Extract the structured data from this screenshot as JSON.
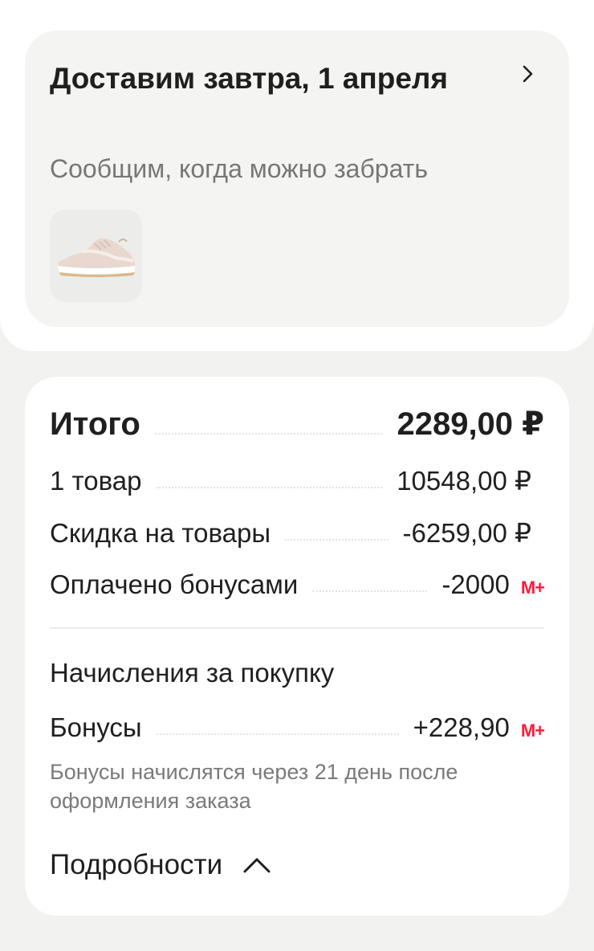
{
  "delivery": {
    "title": "Доставим завтра, 1 апреля",
    "subtitle": "Сообщим, когда можно забрать",
    "product_image": "sneaker-thumbnail"
  },
  "summary": {
    "total_label": "Итого",
    "total_value": "2289,00 ₽",
    "items_label": "1 товар",
    "items_value": "10548,00 ₽",
    "discount_label": "Скидка на товары",
    "discount_value": "-6259,00 ₽",
    "bonus_paid_label": "Оплачено бонусами",
    "bonus_paid_value": "-2000",
    "bonus_currency": "М+"
  },
  "accrual": {
    "title": "Начисления за покупку",
    "bonus_label": "Бонусы",
    "bonus_value": "+228,90",
    "bonus_currency": "М+",
    "note": "Бонусы начислятся через 21 день после оформления заказа"
  },
  "details_label": "Подробности",
  "colors": {
    "accent": "#ff1a3c",
    "background": "#f2f2f0",
    "card": "#ffffff",
    "muted": "#777777"
  }
}
